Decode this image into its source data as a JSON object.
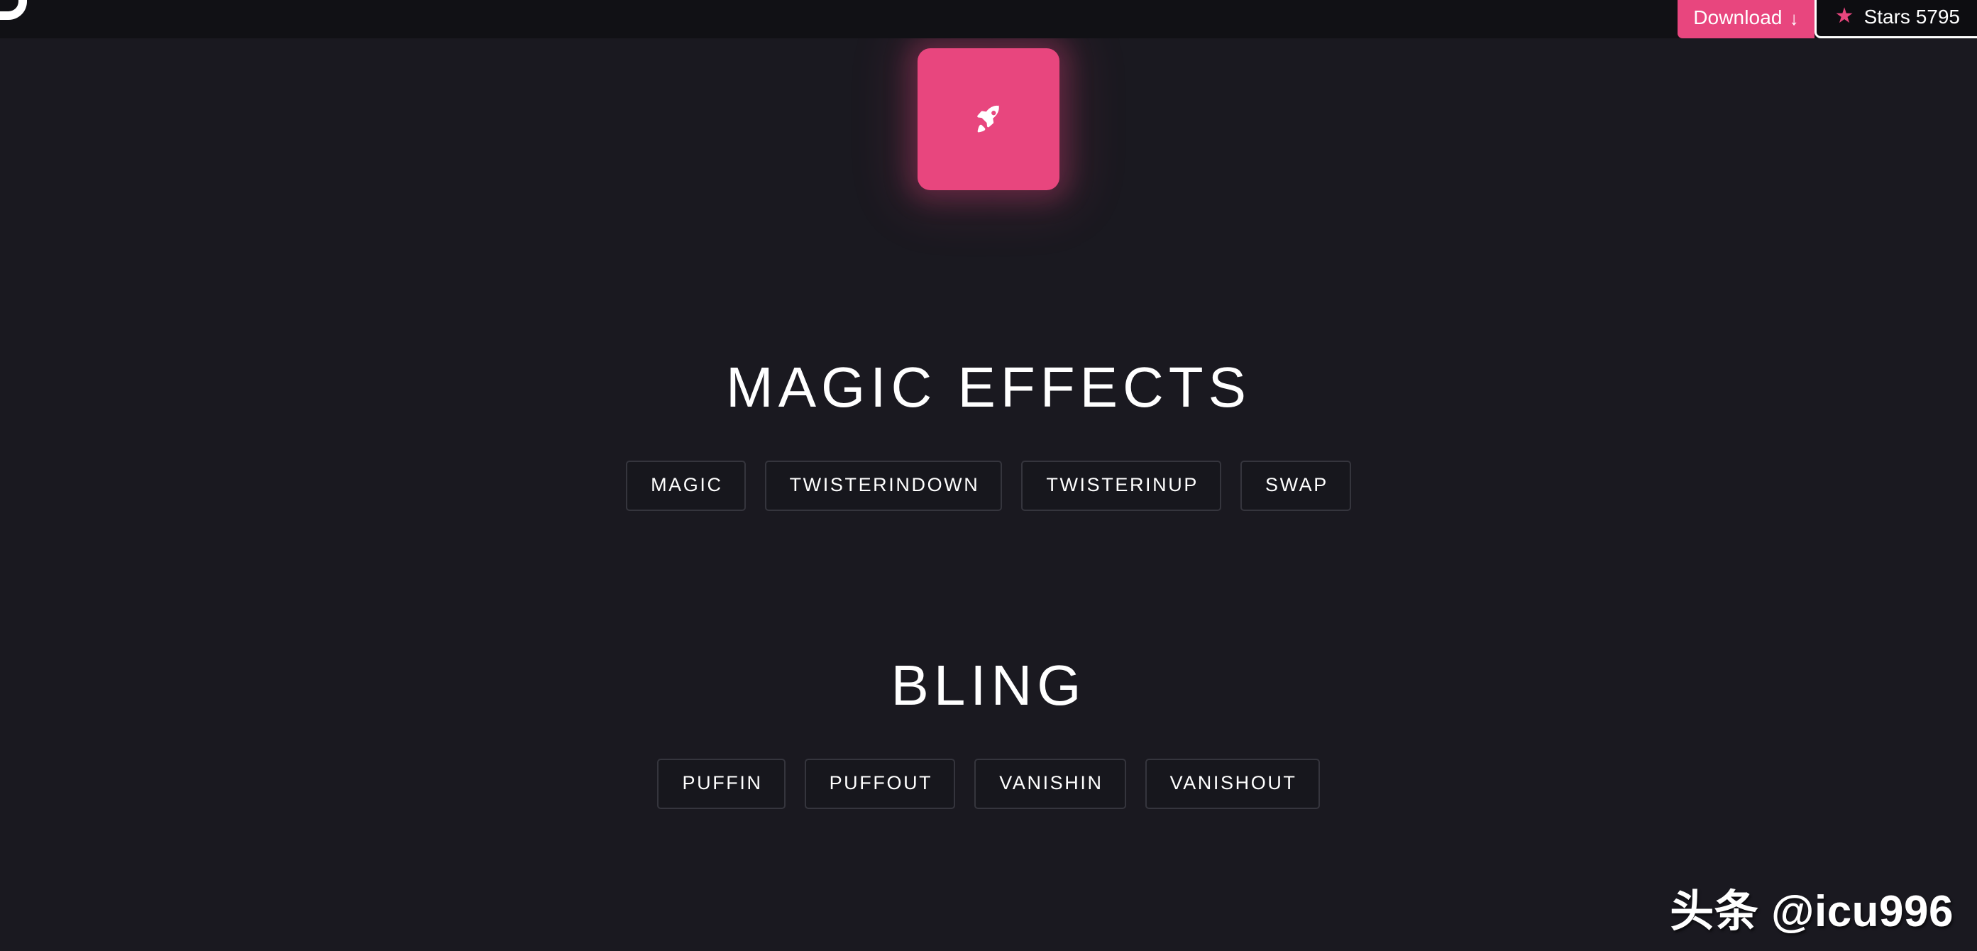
{
  "topbar": {
    "logo_icon": "brand-logo-icon",
    "download": {
      "label": "Download",
      "icon": "download-arrow-icon",
      "arrow_glyph": "↓",
      "background": "#e8467e"
    },
    "stars": {
      "icon": "star-icon",
      "star_glyph": "★",
      "star_color": "#e8467e",
      "label": "Stars 5795",
      "text": "Stars",
      "count": "5795"
    }
  },
  "hero": {
    "icon": "rocket-icon",
    "card_color": "#e8467e"
  },
  "sections": [
    {
      "title": "MAGIC EFFECTS",
      "buttons": [
        {
          "label": "MAGIC"
        },
        {
          "label": "TWISTERINDOWN"
        },
        {
          "label": "TWISTERINUP"
        },
        {
          "label": "SWAP"
        }
      ]
    },
    {
      "title": "BLING",
      "buttons": [
        {
          "label": "PUFFIN"
        },
        {
          "label": "PUFFOUT"
        },
        {
          "label": "VANISHIN"
        },
        {
          "label": "VANISHOUT"
        }
      ]
    }
  ],
  "watermark": {
    "text": "头条 @icu996"
  },
  "theme": {
    "background": "#1a1920",
    "topbar_background": "#111115",
    "accent": "#e8467e",
    "button_background": "#17171d",
    "button_border": "#35353d",
    "text": "#ffffff"
  }
}
